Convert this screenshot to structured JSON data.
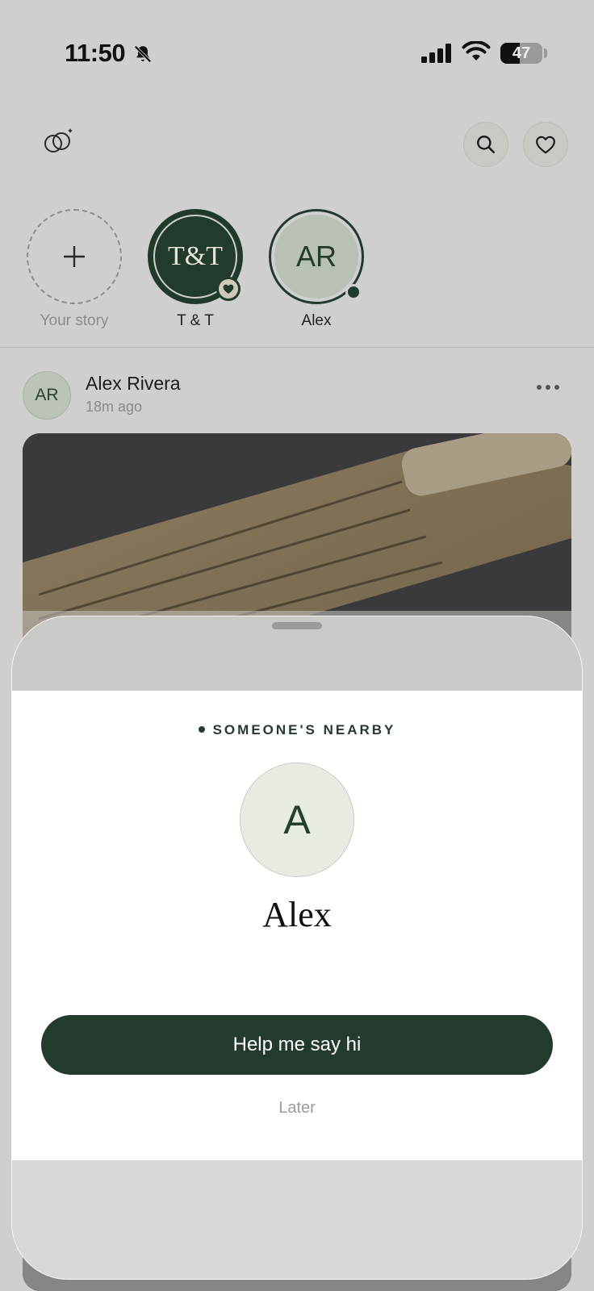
{
  "status_bar": {
    "time": "11:50",
    "battery": "47",
    "battery_level": 0.47,
    "icons": [
      "bell-slash-icon",
      "cellular-signal-icon",
      "wifi-icon",
      "battery-icon"
    ]
  },
  "header": {
    "logo_icon": "rings-logo-icon",
    "actions": [
      "search-icon",
      "heart-icon"
    ]
  },
  "stories": [
    {
      "label": "Your story",
      "icon": "plus-icon"
    },
    {
      "label": "T & T",
      "initials": "T&T",
      "badge_icon": "heart-icon"
    },
    {
      "label": "Alex",
      "initials": "AR"
    }
  ],
  "post": {
    "avatar_initials": "AR",
    "author": "Alex Rivera",
    "time": "18m ago",
    "more_icon": "more-horizontal-icon",
    "image": "calligraphy-scroll-photo"
  },
  "sheet": {
    "eyebrow": "SOMEONE'S NEARBY",
    "avatar_initial": "A",
    "name": "Alex",
    "primary_button": "Help me say hi",
    "secondary_button": "Later"
  },
  "colors": {
    "background": "#cfcfcd",
    "accent": "#233b2c",
    "sheet": "#ffffff",
    "muted_text": "#9a9a98"
  }
}
